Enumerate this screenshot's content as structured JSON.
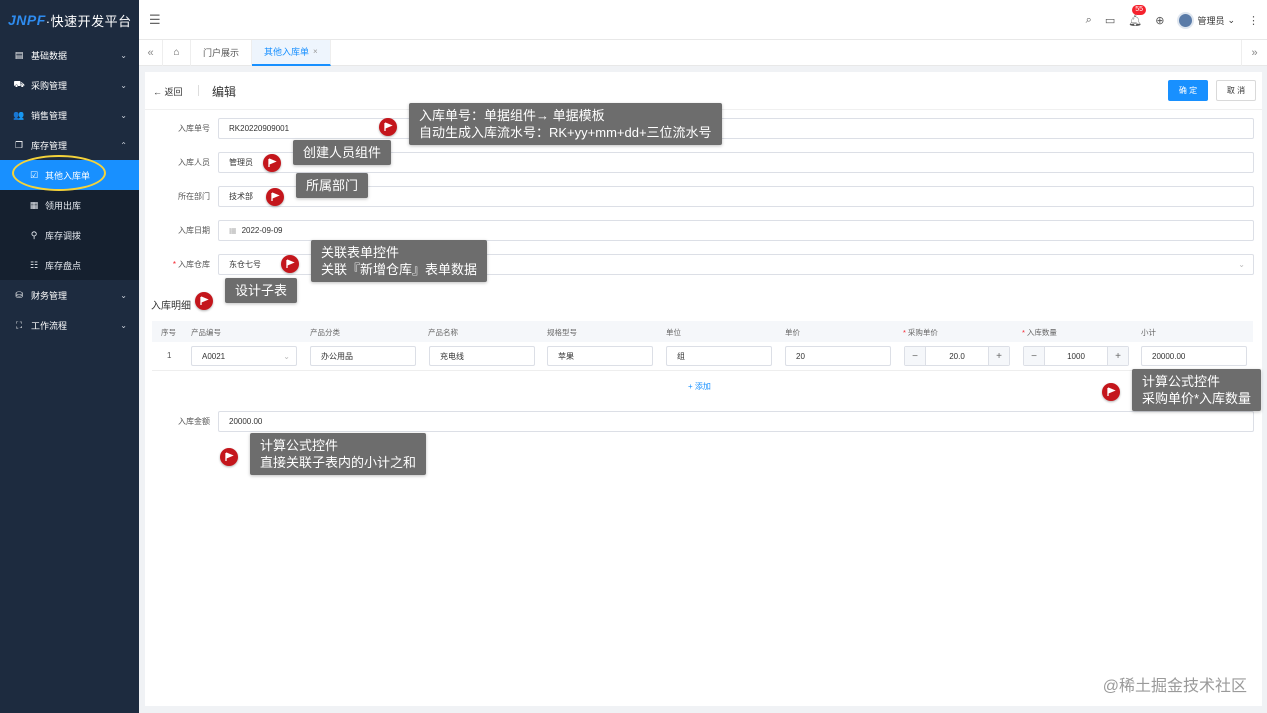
{
  "app": {
    "logo_mark": "JNPF",
    "logo_text": "·快速开发平台"
  },
  "sidebar": {
    "items": [
      {
        "label": "基础数据",
        "icon": "document-icon",
        "glyph": "▤"
      },
      {
        "label": "采购管理",
        "icon": "truck-icon",
        "glyph": "⛟"
      },
      {
        "label": "销售管理",
        "icon": "users-icon",
        "glyph": "👥"
      },
      {
        "label": "库存管理",
        "icon": "copy-icon",
        "glyph": "❐"
      }
    ],
    "sub_items": [
      {
        "label": "其他入库单",
        "glyph": "☑",
        "active": true
      },
      {
        "label": "领用出库",
        "glyph": "▦"
      },
      {
        "label": "库存调拨",
        "glyph": "⚲"
      },
      {
        "label": "库存盘点",
        "glyph": "☷"
      }
    ],
    "bottom_items": [
      {
        "label": "财务管理",
        "glyph": "⛁"
      },
      {
        "label": "工作流程",
        "glyph": "⛶"
      }
    ]
  },
  "header": {
    "notification_count": "55",
    "user_name": "管理员"
  },
  "tabs": {
    "portal": "门户展示",
    "active": "其他入库单"
  },
  "form": {
    "back_label": "返回",
    "title": "编辑",
    "confirm_label": "确 定",
    "cancel_label": "取 消",
    "fields": {
      "order_no": {
        "label": "入库单号",
        "value": "RK20220909001"
      },
      "operator": {
        "label": "入库人员",
        "value": "管理员"
      },
      "department": {
        "label": "所在部门",
        "value": "技术部"
      },
      "date": {
        "label": "入库日期",
        "value": "2022-09-09"
      },
      "warehouse": {
        "label": "入库仓库",
        "value": "东仓七号"
      },
      "amount": {
        "label": "入库金额",
        "value": "20000.00"
      }
    },
    "detail_title": "入库明细",
    "table": {
      "columns": [
        "序号",
        "产品编号",
        "产品分类",
        "产品名称",
        "规格型号",
        "单位",
        "单价",
        "采购单价",
        "入库数量",
        "小计"
      ],
      "row": {
        "index": "1",
        "product_code": "A0021",
        "category": "办公用品",
        "name": "充电线",
        "spec": "苹果",
        "unit": "组",
        "price": "20",
        "purchase_price": "20.0",
        "quantity": "1000",
        "subtotal": "20000.00"
      },
      "add_label": "+ 添加"
    }
  },
  "annotations": {
    "order_no_1": "入库单号：单据组件→ 单据模板",
    "order_no_2": "自动生成入库流水号：RK+yy+mm+dd+三位流水号",
    "operator": "创建人员组件",
    "department": "所属部门",
    "warehouse_1": "关联表单控件",
    "warehouse_2": "关联『新增仓库』表单数据",
    "subtable": "设计子表",
    "subtotal_1": "计算公式控件",
    "subtotal_2": "采购单价*入库数量",
    "amount_1": "计算公式控件",
    "amount_2": "直接关联子表内的小计之和"
  },
  "watermark": "@稀土掘金技术社区"
}
